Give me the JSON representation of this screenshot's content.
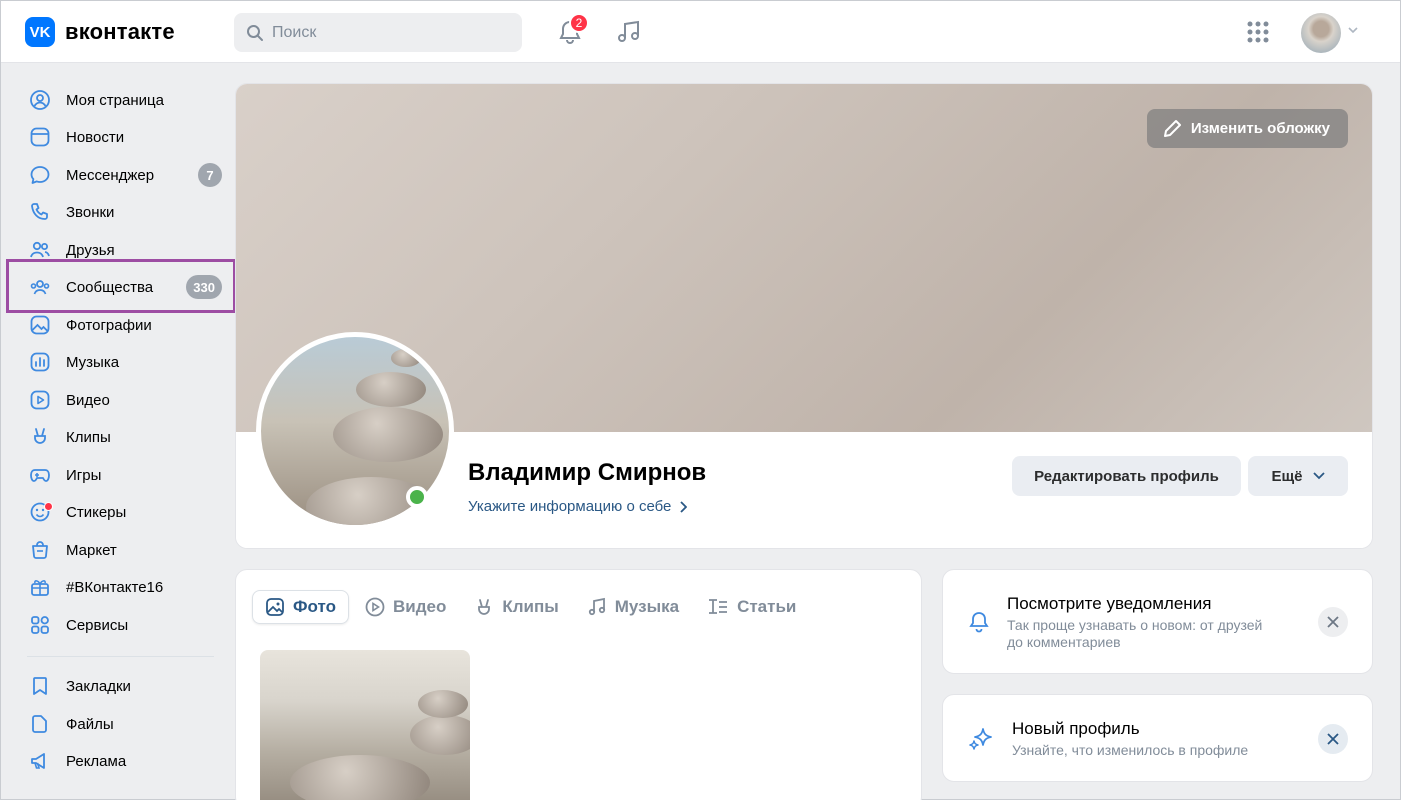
{
  "header": {
    "logo_mark": "VK",
    "logo_text": "вконтакте",
    "search_placeholder": "Поиск",
    "notifications_count": "2"
  },
  "sidebar": {
    "items": [
      {
        "label": "Моя страница",
        "icon": "user-circle-icon"
      },
      {
        "label": "Новости",
        "icon": "newsfeed-icon"
      },
      {
        "label": "Мессенджер",
        "icon": "message-icon",
        "badge": "7"
      },
      {
        "label": "Звонки",
        "icon": "phone-icon"
      },
      {
        "label": "Друзья",
        "icon": "friends-icon"
      },
      {
        "label": "Сообщества",
        "icon": "groups-icon",
        "badge": "330"
      },
      {
        "label": "Фотографии",
        "icon": "photo-icon"
      },
      {
        "label": "Музыка",
        "icon": "music-icon"
      },
      {
        "label": "Видео",
        "icon": "video-icon"
      },
      {
        "label": "Клипы",
        "icon": "clips-icon"
      },
      {
        "label": "Игры",
        "icon": "gamepad-icon"
      },
      {
        "label": "Стикеры",
        "icon": "sticker-icon"
      },
      {
        "label": "Маркет",
        "icon": "market-icon"
      },
      {
        "label": "#ВКонтакте16",
        "icon": "gift-icon"
      },
      {
        "label": "Сервисы",
        "icon": "services-icon"
      },
      {
        "label": "Закладки",
        "icon": "bookmark-icon"
      },
      {
        "label": "Файлы",
        "icon": "file-icon"
      },
      {
        "label": "Реклама",
        "icon": "megaphone-icon"
      }
    ]
  },
  "profile": {
    "cover_button": "Изменить обложку",
    "name": "Владимир Смирнов",
    "info_link": "Укажите информацию о себе",
    "edit_button": "Редактировать профиль",
    "more_button": "Ещё"
  },
  "media": {
    "tabs": [
      "Фото",
      "Видео",
      "Клипы",
      "Музыка",
      "Статьи"
    ],
    "active_tab": "Фото"
  },
  "notices": [
    {
      "title": "Посмотрите уведомления",
      "subtitle_line1": "Так проще узнавать о новом: от друзей",
      "subtitle_line2": "до комментариев",
      "icon": "bell-icon"
    },
    {
      "title": "Новый профиль",
      "subtitle_line1": "Узнайте, что изменилось в профиле",
      "icon": "sparkle-icon"
    }
  ],
  "colors": {
    "brand": "#0077ff",
    "link": "#2a5885",
    "badge": "#a0a6ae",
    "online": "#4bb34b",
    "highlight": "#9d4da3"
  }
}
